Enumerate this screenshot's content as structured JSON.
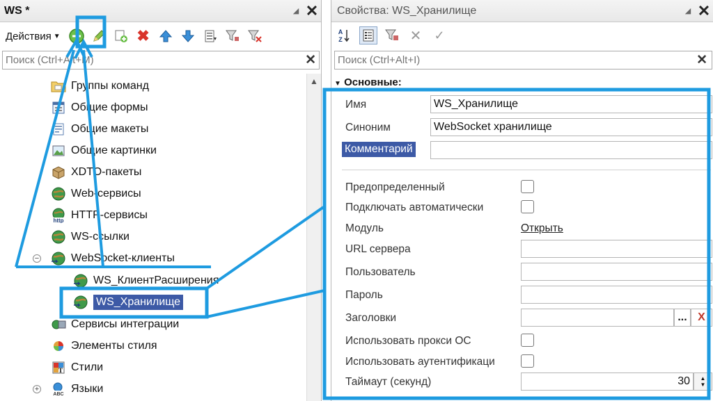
{
  "left_panel": {
    "title": "WS *",
    "actions_label": "Действия",
    "search_placeholder": "Поиск (Ctrl+Alt+M)",
    "tree": [
      {
        "label": "Группы команд",
        "icon": "folder-icon"
      },
      {
        "label": "Общие формы",
        "icon": "form-icon"
      },
      {
        "label": "Общие макеты",
        "icon": "template-icon"
      },
      {
        "label": "Общие картинки",
        "icon": "picture-icon"
      },
      {
        "label": "XDTO-пакеты",
        "icon": "package-icon"
      },
      {
        "label": "Web-сервисы",
        "icon": "globe-icon"
      },
      {
        "label": "HTTP-сервисы",
        "icon": "http-globe-icon"
      },
      {
        "label": "WS-ссылки",
        "icon": "globe-icon"
      },
      {
        "label": "WebSocket-клиенты",
        "icon": "websocket-globe-icon"
      },
      {
        "label": "WS_КлиентРасширения",
        "icon": "websocket-globe-icon"
      },
      {
        "label": "WS_Хранилище",
        "icon": "websocket-globe-icon",
        "selected": true
      },
      {
        "label": "Сервисы интеграции",
        "icon": "integration-icon"
      },
      {
        "label": "Элементы стиля",
        "icon": "style-element-icon"
      },
      {
        "label": "Стили",
        "icon": "style-icon"
      },
      {
        "label": "Языки",
        "icon": "language-icon"
      }
    ]
  },
  "right_panel": {
    "title": "Свойства: WS_Хранилище",
    "search_placeholder": "Поиск (Ctrl+Alt+I)",
    "section": "Основные:",
    "fields": {
      "name_label": "Имя",
      "name_value": "WS_Хранилище",
      "synonym_label": "Синоним",
      "synonym_value": "WebSocket хранилище",
      "comment_label": "Комментарий",
      "comment_value": "",
      "predefined_label": "Предопределенный",
      "autoconnect_label": "Подключать автоматически",
      "module_label": "Модуль",
      "module_link": "Открыть",
      "url_label": "URL сервера",
      "url_value": "",
      "user_label": "Пользователь",
      "user_value": "",
      "password_label": "Пароль",
      "password_value": "",
      "headers_label": "Заголовки",
      "headers_value": "",
      "headers_button": "...",
      "headers_clear": "X",
      "proxy_label": "Использовать прокси ОС",
      "auth_label": "Использовать аутентификаци",
      "timeout_label": "Таймаут (секунд)",
      "timeout_value": "30"
    }
  },
  "colors": {
    "highlight_blue": "#1e9be0",
    "selection_blue": "#3d5aa6"
  }
}
